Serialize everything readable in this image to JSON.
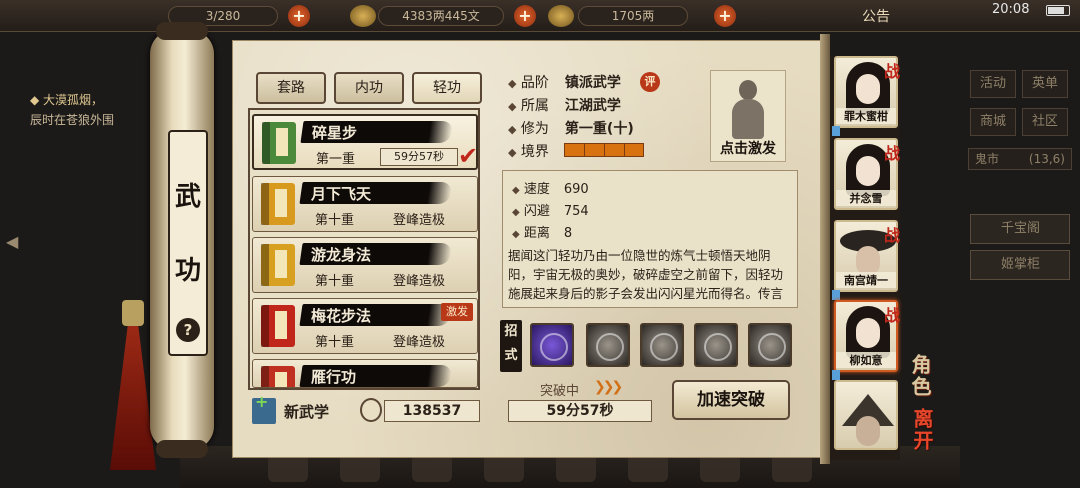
{
  "hud": {
    "counter1": "3/280",
    "counter2": "4383两445文",
    "counter3": "1705两",
    "announcement": "公告",
    "time": "20:08"
  },
  "left_quest": {
    "title": "◆ 大漠孤烟，",
    "line2": "辰时在苍狼外围"
  },
  "right_panel": {
    "btn_activity": "活动",
    "btn_market": "商城",
    "btn_heroes": "英单",
    "btn_community": "社区",
    "ghost_market": "鬼市",
    "ghost_coord": "(13,6)",
    "qian_bao_ge": "千宝阁",
    "yao_zhang_gui": "姬掌柜"
  },
  "scroll": {
    "title_char1": "武",
    "title_char2": "功",
    "help": "?"
  },
  "tabs": [
    {
      "label": "套路"
    },
    {
      "label": "内功"
    },
    {
      "label": "轻功"
    }
  ],
  "skills": [
    {
      "name": "碎星步",
      "level": "第一重",
      "timer": "59分57秒",
      "color": "#4a8a3a"
    },
    {
      "name": "月下飞天",
      "level": "第十重",
      "status": "登峰造极",
      "color": "#d89a1e"
    },
    {
      "name": "游龙身法",
      "level": "第十重",
      "status": "登峰造极",
      "color": "#d8a020"
    },
    {
      "name": "梅花步法",
      "level": "第十重",
      "status": "登峰造极",
      "badge": "激发",
      "color": "#c0261a"
    },
    {
      "name": "雁行功",
      "color": "#c03020"
    }
  ],
  "footer": {
    "new_skill": "新武学",
    "points": "138537"
  },
  "detail": {
    "grade_label": "品阶",
    "grade_value": "镇派武学",
    "rate": "评",
    "belong_label": "所属",
    "belong_value": "江湖武学",
    "cultivation_label": "修为",
    "cultivation_value": "第一重(十)",
    "realm_label": "境界",
    "activate_label": "点击激发",
    "stats": [
      {
        "label": "速度",
        "value": "690"
      },
      {
        "label": "闪避",
        "value": "754"
      },
      {
        "label": "距离",
        "value": "8"
      }
    ],
    "description": "据闻这门轻功乃由一位隐世的炼气士顿悟天地阴阳，宇宙无极的奥妙，破碎虚空之前留下，因轻功施展起来身后的影子会发出闪闪星光而得名。传言说，只要学会了这门轻功",
    "moves_label": "招式",
    "breakthrough_label": "突破中",
    "breakthrough_timer": "59分57秒",
    "speed_up": "加速突破"
  },
  "party": [
    {
      "name": "罪木蜜柑"
    },
    {
      "name": "并念雪"
    },
    {
      "name": "南宫靖一"
    },
    {
      "name": "柳如意"
    },
    {
      "name": ""
    }
  ],
  "party_mark": "战",
  "side_text": {
    "role": "角色",
    "leave": "离开"
  }
}
